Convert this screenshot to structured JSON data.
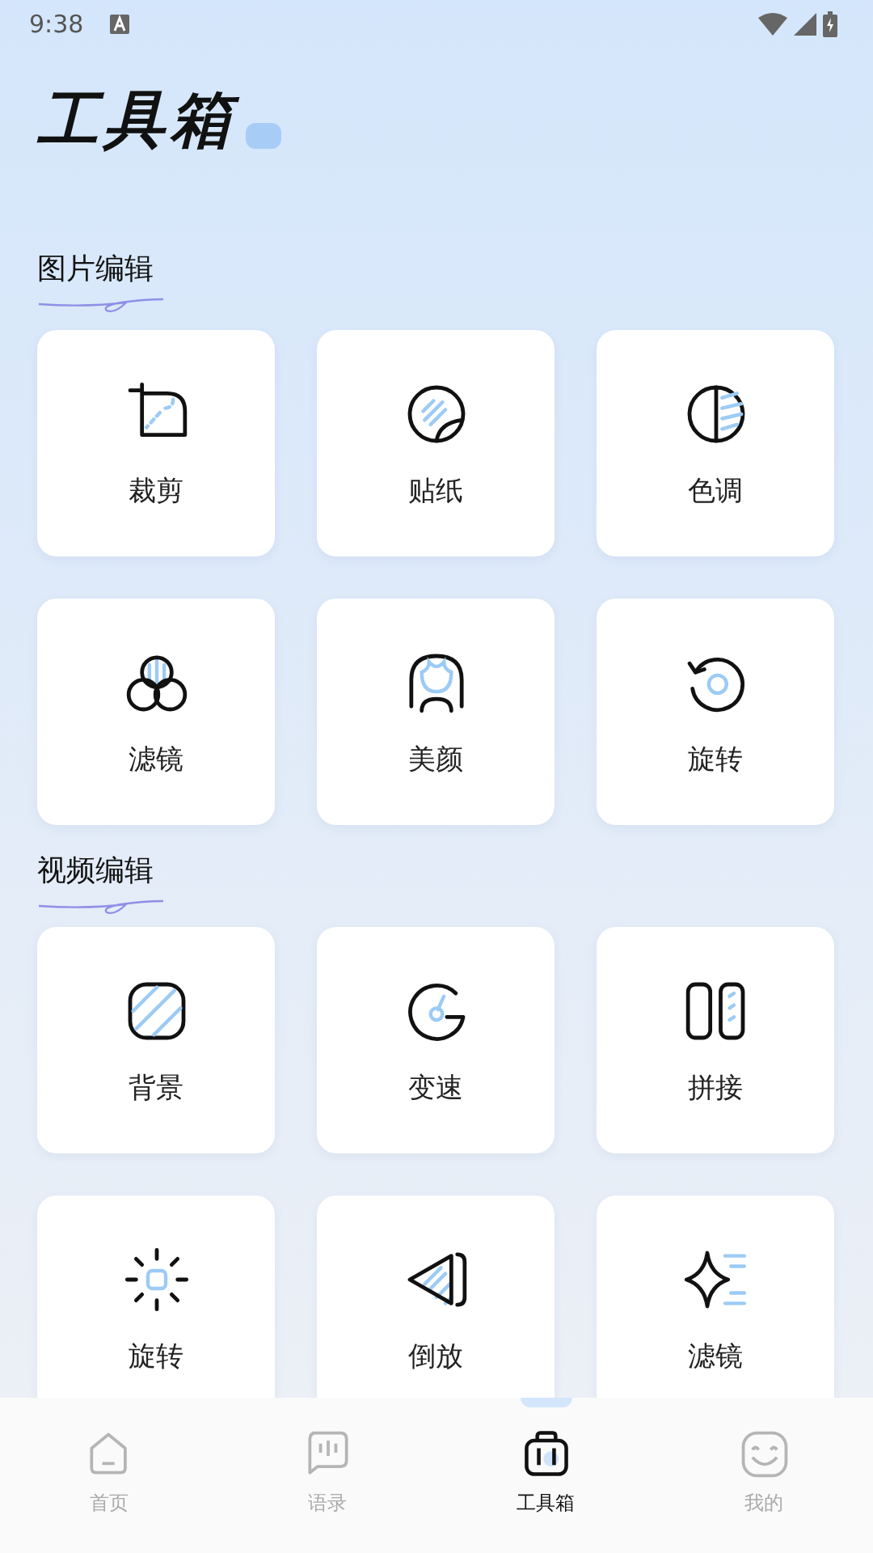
{
  "status_bar": {
    "time": "9:38"
  },
  "title": "工具箱",
  "sections": [
    {
      "title": "图片编辑",
      "items": [
        {
          "label": "裁剪"
        },
        {
          "label": "贴纸"
        },
        {
          "label": "色调"
        },
        {
          "label": "滤镜"
        },
        {
          "label": "美颜"
        },
        {
          "label": "旋转"
        }
      ]
    },
    {
      "title": "视频编辑",
      "items": [
        {
          "label": "背景"
        },
        {
          "label": "变速"
        },
        {
          "label": "拼接"
        },
        {
          "label": "旋转"
        },
        {
          "label": "倒放"
        },
        {
          "label": "滤镜"
        }
      ]
    }
  ],
  "tab_bar": [
    {
      "label": "首页",
      "selected": false
    },
    {
      "label": "语录",
      "selected": false
    },
    {
      "label": "工具箱",
      "selected": true
    },
    {
      "label": "我的",
      "selected": false
    }
  ]
}
